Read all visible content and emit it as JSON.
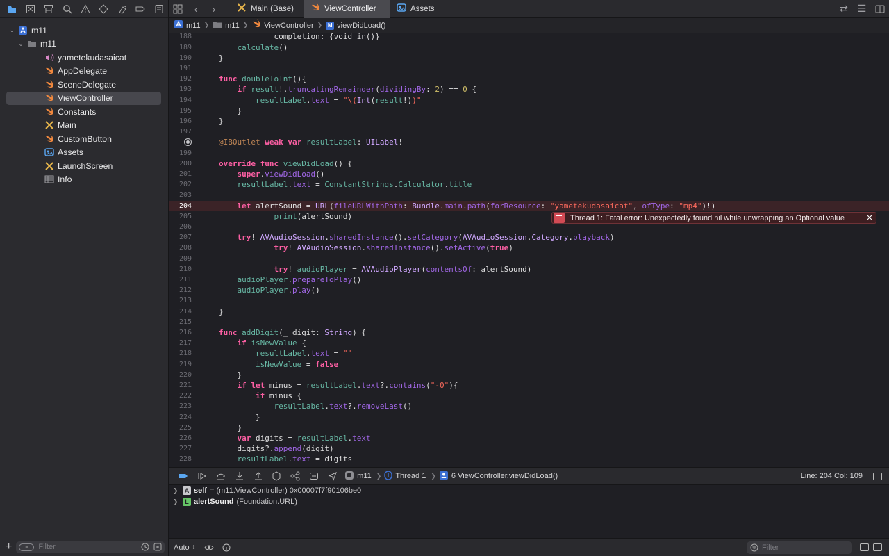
{
  "colors": {
    "selection": "#47474d",
    "error_line": "#3b2327",
    "error_badge": "#d34b55",
    "keyword": "#fc5fa3",
    "string": "#fc6a5d",
    "number": "#d0bf69",
    "type": "#d0a8ff",
    "function": "#67b7a4",
    "swift_orange": "#f0883e"
  },
  "navigator": {
    "toolbar_icons": [
      "folder-icon",
      "source-control-icon",
      "symbol-hierarchy-icon",
      "search-icon",
      "warning-icon",
      "test-diamond-icon",
      "debug-spray-icon",
      "breakpoint-icon",
      "report-icon"
    ],
    "tree": [
      {
        "label": "m11",
        "icon": "project-icon",
        "level": 0,
        "expanded": true
      },
      {
        "label": "m11",
        "icon": "folder-icon",
        "level": 1,
        "expanded": true
      },
      {
        "label": "yametekudasaicat",
        "icon": "audio-file-icon",
        "level": 2
      },
      {
        "label": "AppDelegate",
        "icon": "swift-file-icon",
        "level": 2
      },
      {
        "label": "SceneDelegate",
        "icon": "swift-file-icon",
        "level": 2
      },
      {
        "label": "ViewController",
        "icon": "swift-file-icon",
        "level": 2,
        "selected": true
      },
      {
        "label": "Constants",
        "icon": "swift-file-icon",
        "level": 2
      },
      {
        "label": "Main",
        "icon": "storyboard-icon",
        "level": 2
      },
      {
        "label": "CustomButton",
        "icon": "swift-file-icon",
        "level": 2
      },
      {
        "label": "Assets",
        "icon": "asset-catalog-icon",
        "level": 2
      },
      {
        "label": "LaunchScreen",
        "icon": "storyboard-icon",
        "level": 2
      },
      {
        "label": "Info",
        "icon": "plist-icon",
        "level": 2
      }
    ],
    "filter_placeholder": "Filter"
  },
  "tabs": [
    {
      "label": "Main (Base)",
      "icon": "storyboard-icon",
      "active": false
    },
    {
      "label": "ViewController",
      "icon": "swift-file-icon",
      "active": true
    },
    {
      "label": "Assets",
      "icon": "asset-catalog-icon",
      "active": false
    }
  ],
  "jumpbar": {
    "crumbs": [
      {
        "label": "m11",
        "icon": "project-icon"
      },
      {
        "label": "m11",
        "icon": "folder-icon"
      },
      {
        "label": "ViewController",
        "icon": "swift-file-icon"
      },
      {
        "label": "viewDidLoad()",
        "icon": "method-icon"
      }
    ]
  },
  "editor": {
    "current_line": 204,
    "breakpoint_line": 198,
    "lines": [
      {
        "n": "188",
        "t": [
          [
            "plain",
            "            "
          ],
          [
            "plain",
            "completion: {void in()}"
          ]
        ]
      },
      {
        "n": "189",
        "t": [
          [
            "plain",
            "    "
          ],
          [
            "fn",
            "calculate"
          ],
          [
            "plain",
            "()"
          ]
        ]
      },
      {
        "n": "190",
        "t": [
          [
            "plain",
            "}"
          ]
        ]
      },
      {
        "n": "191",
        "t": []
      },
      {
        "n": "192",
        "t": [
          [
            "kw",
            "func"
          ],
          [
            "plain",
            " "
          ],
          [
            "fn",
            "doubleToInt"
          ],
          [
            "plain",
            "(){"
          ]
        ]
      },
      {
        "n": "193",
        "t": [
          [
            "plain",
            "    "
          ],
          [
            "kw",
            "if"
          ],
          [
            "plain",
            " "
          ],
          [
            "fn",
            "result"
          ],
          [
            "plain",
            "!."
          ],
          [
            "prop",
            "truncatingRemainder"
          ],
          [
            "plain",
            "("
          ],
          [
            "prop",
            "dividingBy"
          ],
          [
            "plain",
            ": "
          ],
          [
            "num",
            "2"
          ],
          [
            "plain",
            ") == "
          ],
          [
            "num",
            "0"
          ],
          [
            "plain",
            " {"
          ]
        ]
      },
      {
        "n": "194",
        "t": [
          [
            "plain",
            "        "
          ],
          [
            "fn",
            "resultLabel"
          ],
          [
            "plain",
            "."
          ],
          [
            "prop",
            "text"
          ],
          [
            "plain",
            " = "
          ],
          [
            "str",
            "\"\\("
          ],
          [
            "typ",
            "Int"
          ],
          [
            "plain",
            "("
          ],
          [
            "fn",
            "result"
          ],
          [
            "plain",
            "!)"
          ],
          [
            "str",
            ")\""
          ]
        ]
      },
      {
        "n": "195",
        "t": [
          [
            "plain",
            "    }"
          ]
        ]
      },
      {
        "n": "196",
        "t": [
          [
            "plain",
            "}"
          ]
        ]
      },
      {
        "n": "197",
        "t": []
      },
      {
        "n": "198",
        "t": [
          [
            "attr",
            "@IBOutlet"
          ],
          [
            "plain",
            " "
          ],
          [
            "kw",
            "weak"
          ],
          [
            "plain",
            " "
          ],
          [
            "kw",
            "var"
          ],
          [
            "plain",
            " "
          ],
          [
            "fn",
            "resultLabel"
          ],
          [
            "plain",
            ": "
          ],
          [
            "typ",
            "UILabel"
          ],
          [
            "plain",
            "!"
          ]
        ]
      },
      {
        "n": "199",
        "t": []
      },
      {
        "n": "200",
        "t": [
          [
            "kw",
            "override"
          ],
          [
            "plain",
            " "
          ],
          [
            "kw",
            "func"
          ],
          [
            "plain",
            " "
          ],
          [
            "fn",
            "viewDidLoad"
          ],
          [
            "plain",
            "() {"
          ]
        ]
      },
      {
        "n": "201",
        "t": [
          [
            "plain",
            "    "
          ],
          [
            "kw",
            "super"
          ],
          [
            "plain",
            "."
          ],
          [
            "prop",
            "viewDidLoad"
          ],
          [
            "plain",
            "()"
          ]
        ]
      },
      {
        "n": "202",
        "t": [
          [
            "plain",
            "    "
          ],
          [
            "fn",
            "resultLabel"
          ],
          [
            "plain",
            "."
          ],
          [
            "prop",
            "text"
          ],
          [
            "plain",
            " = "
          ],
          [
            "fn",
            "ConstantStrings"
          ],
          [
            "plain",
            "."
          ],
          [
            "fn",
            "Calculator"
          ],
          [
            "plain",
            "."
          ],
          [
            "fn",
            "title"
          ]
        ]
      },
      {
        "n": "203",
        "t": []
      },
      {
        "n": "204",
        "t": [
          [
            "plain",
            "    "
          ],
          [
            "kw",
            "let"
          ],
          [
            "plain",
            " alertSound = "
          ],
          [
            "typ",
            "URL"
          ],
          [
            "plain",
            "("
          ],
          [
            "prop",
            "fileURLWithPath"
          ],
          [
            "plain",
            ": "
          ],
          [
            "typ",
            "Bundle"
          ],
          [
            "plain",
            "."
          ],
          [
            "prop",
            "main"
          ],
          [
            "plain",
            "."
          ],
          [
            "prop",
            "path"
          ],
          [
            "plain",
            "("
          ],
          [
            "prop",
            "forResource"
          ],
          [
            "plain",
            ": "
          ],
          [
            "str",
            "\"yametekudasaicat\""
          ],
          [
            "plain",
            ", "
          ],
          [
            "prop",
            "ofType"
          ],
          [
            "plain",
            ": "
          ],
          [
            "str",
            "\"mp4\""
          ],
          [
            "plain",
            ")!)"
          ]
        ]
      },
      {
        "n": "205",
        "t": [
          [
            "plain",
            "            "
          ],
          [
            "fn",
            "print"
          ],
          [
            "plain",
            "(alertSound)"
          ]
        ]
      },
      {
        "n": "206",
        "t": []
      },
      {
        "n": "207",
        "t": [
          [
            "plain",
            "    "
          ],
          [
            "kw",
            "try"
          ],
          [
            "plain",
            "! "
          ],
          [
            "typ",
            "AVAudioSession"
          ],
          [
            "plain",
            "."
          ],
          [
            "prop",
            "sharedInstance"
          ],
          [
            "plain",
            "()."
          ],
          [
            "prop",
            "setCategory"
          ],
          [
            "plain",
            "("
          ],
          [
            "typ",
            "AVAudioSession"
          ],
          [
            "plain",
            "."
          ],
          [
            "typ",
            "Category"
          ],
          [
            "plain",
            "."
          ],
          [
            "prop",
            "playback"
          ],
          [
            "plain",
            ")"
          ]
        ]
      },
      {
        "n": "208",
        "t": [
          [
            "plain",
            "            "
          ],
          [
            "kw",
            "try"
          ],
          [
            "plain",
            "! "
          ],
          [
            "typ",
            "AVAudioSession"
          ],
          [
            "plain",
            "."
          ],
          [
            "prop",
            "sharedInstance"
          ],
          [
            "plain",
            "()."
          ],
          [
            "prop",
            "setActive"
          ],
          [
            "plain",
            "("
          ],
          [
            "kw",
            "true"
          ],
          [
            "plain",
            ")"
          ]
        ]
      },
      {
        "n": "209",
        "t": []
      },
      {
        "n": "210",
        "t": [
          [
            "plain",
            "            "
          ],
          [
            "kw",
            "try"
          ],
          [
            "plain",
            "! "
          ],
          [
            "fn",
            "audioPlayer"
          ],
          [
            "plain",
            " = "
          ],
          [
            "typ",
            "AVAudioPlayer"
          ],
          [
            "plain",
            "("
          ],
          [
            "prop",
            "contentsOf"
          ],
          [
            "plain",
            ": alertSound)"
          ]
        ]
      },
      {
        "n": "211",
        "t": [
          [
            "plain",
            "    "
          ],
          [
            "fn",
            "audioPlayer"
          ],
          [
            "plain",
            "."
          ],
          [
            "prop",
            "prepareToPlay"
          ],
          [
            "plain",
            "()"
          ]
        ]
      },
      {
        "n": "212",
        "t": [
          [
            "plain",
            "    "
          ],
          [
            "fn",
            "audioPlayer"
          ],
          [
            "plain",
            "."
          ],
          [
            "prop",
            "play"
          ],
          [
            "plain",
            "()"
          ]
        ]
      },
      {
        "n": "213",
        "t": []
      },
      {
        "n": "214",
        "t": [
          [
            "plain",
            "}"
          ]
        ]
      },
      {
        "n": "215",
        "t": []
      },
      {
        "n": "216",
        "t": [
          [
            "kw",
            "func"
          ],
          [
            "plain",
            " "
          ],
          [
            "fn",
            "addDigit"
          ],
          [
            "plain",
            "(_ digit: "
          ],
          [
            "typ",
            "String"
          ],
          [
            "plain",
            ") {"
          ]
        ]
      },
      {
        "n": "217",
        "t": [
          [
            "plain",
            "    "
          ],
          [
            "kw",
            "if"
          ],
          [
            "plain",
            " "
          ],
          [
            "fn",
            "isNewValue"
          ],
          [
            "plain",
            " {"
          ]
        ]
      },
      {
        "n": "218",
        "t": [
          [
            "plain",
            "        "
          ],
          [
            "fn",
            "resultLabel"
          ],
          [
            "plain",
            "."
          ],
          [
            "prop",
            "text"
          ],
          [
            "plain",
            " = "
          ],
          [
            "str",
            "\"\""
          ]
        ]
      },
      {
        "n": "219",
        "t": [
          [
            "plain",
            "        "
          ],
          [
            "fn",
            "isNewValue"
          ],
          [
            "plain",
            " = "
          ],
          [
            "kw",
            "false"
          ]
        ]
      },
      {
        "n": "220",
        "t": [
          [
            "plain",
            "    }"
          ]
        ]
      },
      {
        "n": "221",
        "t": [
          [
            "plain",
            "    "
          ],
          [
            "kw",
            "if"
          ],
          [
            "plain",
            " "
          ],
          [
            "kw",
            "let"
          ],
          [
            "plain",
            " minus = "
          ],
          [
            "fn",
            "resultLabel"
          ],
          [
            "plain",
            "."
          ],
          [
            "prop",
            "text"
          ],
          [
            "plain",
            "?."
          ],
          [
            "prop",
            "contains"
          ],
          [
            "plain",
            "("
          ],
          [
            "str",
            "\"-0\""
          ],
          [
            "plain",
            "){"
          ]
        ]
      },
      {
        "n": "222",
        "t": [
          [
            "plain",
            "        "
          ],
          [
            "kw",
            "if"
          ],
          [
            "plain",
            " minus {"
          ]
        ]
      },
      {
        "n": "223",
        "t": [
          [
            "plain",
            "            "
          ],
          [
            "fn",
            "resultLabel"
          ],
          [
            "plain",
            "."
          ],
          [
            "prop",
            "text"
          ],
          [
            "plain",
            "?."
          ],
          [
            "prop",
            "removeLast"
          ],
          [
            "plain",
            "()"
          ]
        ]
      },
      {
        "n": "224",
        "t": [
          [
            "plain",
            "        }"
          ]
        ]
      },
      {
        "n": "225",
        "t": [
          [
            "plain",
            "    }"
          ]
        ]
      },
      {
        "n": "226",
        "t": [
          [
            "plain",
            "    "
          ],
          [
            "kw",
            "var"
          ],
          [
            "plain",
            " digits = "
          ],
          [
            "fn",
            "resultLabel"
          ],
          [
            "plain",
            "."
          ],
          [
            "prop",
            "text"
          ]
        ]
      },
      {
        "n": "227",
        "t": [
          [
            "plain",
            "    digits?."
          ],
          [
            "prop",
            "append"
          ],
          [
            "plain",
            "(digit)"
          ]
        ]
      },
      {
        "n": "228",
        "t": [
          [
            "plain",
            "    "
          ],
          [
            "fn",
            "resultLabel"
          ],
          [
            "plain",
            "."
          ],
          [
            "prop",
            "text"
          ],
          [
            "plain",
            " = digits"
          ]
        ]
      },
      {
        "n": "229",
        "t": [
          [
            "plain",
            "}"
          ]
        ]
      }
    ],
    "error_message": "Thread 1: Fatal error: Unexpectedly found nil while unwrapping an Optional value"
  },
  "debugbar": {
    "buttons": [
      "breakpoints-toggle-icon",
      "continue-icon",
      "step-over-icon",
      "step-into-icon",
      "step-out-icon",
      "view-hierarchy-icon",
      "memory-graph-icon",
      "environment-overrides-icon",
      "location-icon"
    ],
    "crumbs": [
      {
        "label": "m11",
        "icon": "app-icon"
      },
      {
        "label": "Thread 1",
        "icon": "thread-icon"
      },
      {
        "label": "6 ViewController.viewDidLoad()",
        "icon": "frame-icon"
      }
    ],
    "line_col": "Line: 204  Col: 109"
  },
  "variables": [
    {
      "badge": "A",
      "name": "self",
      "value": "= (m11.ViewController) 0x00007f7f90106be0"
    },
    {
      "badge": "L",
      "name": "alertSound",
      "value": "(Foundation.URL)"
    }
  ],
  "bottombar": {
    "auto_label": "Auto",
    "filter_placeholder": "Filter"
  }
}
